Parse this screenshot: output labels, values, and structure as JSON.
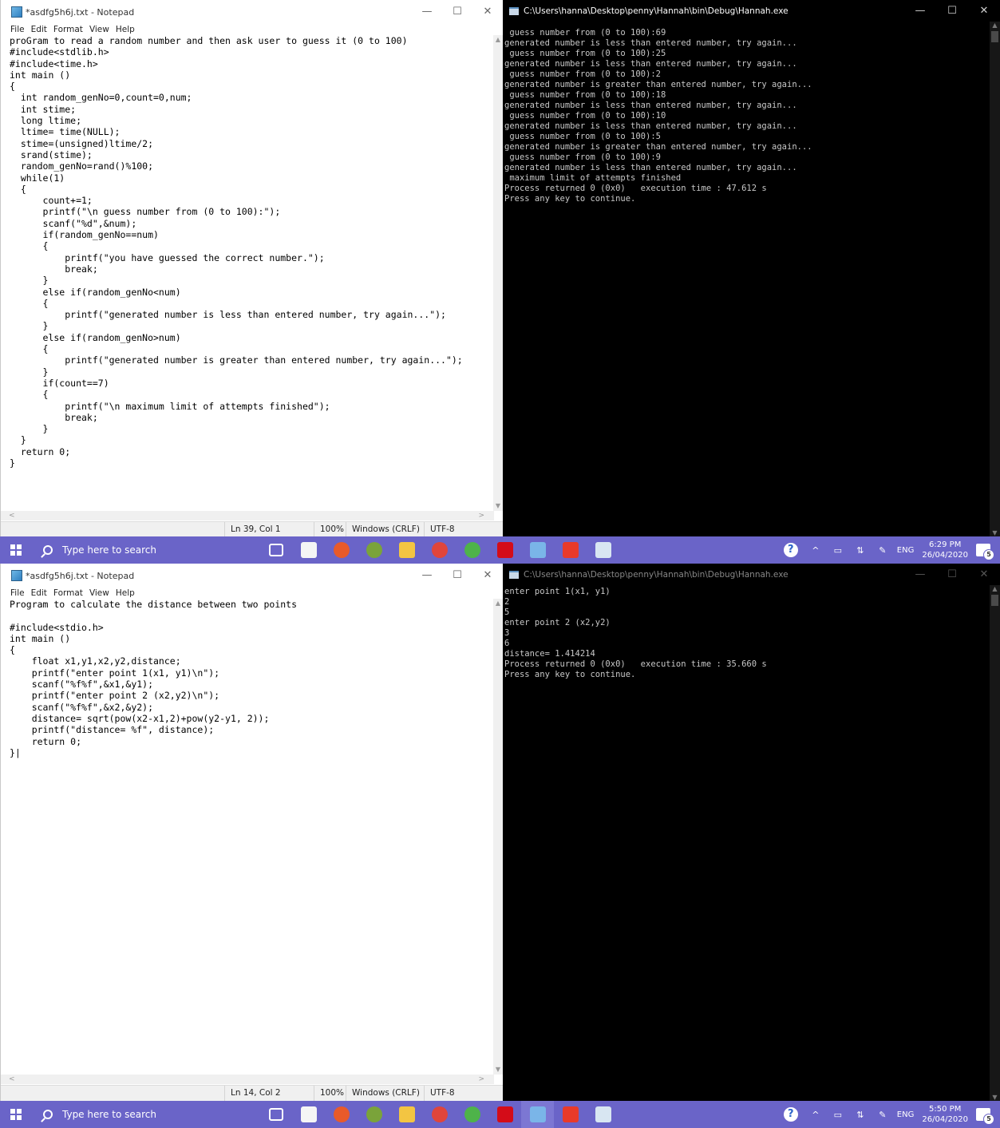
{
  "top": {
    "notepad": {
      "title": "*asdfg5h6j.txt - Notepad",
      "menu": [
        "File",
        "Edit",
        "Format",
        "View",
        "Help"
      ],
      "content": "proGram to read a random number and then ask user to guess it (0 to 100)\n#include<stdlib.h>\n#include<time.h>\nint main ()\n{\n  int random_genNo=0,count=0,num;\n  int stime;\n  long ltime;\n  ltime= time(NULL);\n  stime=(unsigned)ltime/2;\n  srand(stime);\n  random_genNo=rand()%100;\n  while(1)\n  {\n      count+=1;\n      printf(\"\\n guess number from (0 to 100):\");\n      scanf(\"%d\",&num);\n      if(random_genNo==num)\n      {\n          printf(\"you have guessed the correct number.\");\n          break;\n      }\n      else if(random_genNo<num)\n      {\n          printf(\"generated number is less than entered number, try again...\");\n      }\n      else if(random_genNo>num)\n      {\n          printf(\"generated number is greater than entered number, try again...\");\n      }\n      if(count==7)\n      {\n          printf(\"\\n maximum limit of attempts finished\");\n          break;\n      }\n  }\n  return 0;\n}",
      "status": {
        "position": "Ln 39, Col 1",
        "zoom": "100%",
        "eol": "Windows (CRLF)",
        "encoding": "UTF-8"
      }
    },
    "console": {
      "title": "C:\\Users\\hanna\\Desktop\\penny\\Hannah\\bin\\Debug\\Hannah.exe",
      "output": " guess number from (0 to 100):69\ngenerated number is less than entered number, try again...\n guess number from (0 to 100):25\ngenerated number is less than entered number, try again...\n guess number from (0 to 100):2\ngenerated number is greater than entered number, try again...\n guess number from (0 to 100):18\ngenerated number is less than entered number, try again...\n guess number from (0 to 100):10\ngenerated number is less than entered number, try again...\n guess number from (0 to 100):5\ngenerated number is greater than entered number, try again...\n guess number from (0 to 100):9\ngenerated number is less than entered number, try again...\n maximum limit of attempts finished\nProcess returned 0 (0x0)   execution time : 47.612 s\nPress any key to continue."
    },
    "taskbar": {
      "search_placeholder": "Type here to search",
      "lang": "ENG",
      "time": "6:29 PM",
      "date": "26/04/2020",
      "notif_count": "5"
    }
  },
  "bottom": {
    "notepad": {
      "title": "*asdfg5h6j.txt - Notepad",
      "menu": [
        "File",
        "Edit",
        "Format",
        "View",
        "Help"
      ],
      "content": "Program to calculate the distance between two points\n\n#include<stdio.h>\nint main ()\n{\n    float x1,y1,x2,y2,distance;\n    printf(\"enter point 1(x1, y1)\\n\");\n    scanf(\"%f%f\",&x1,&y1);\n    printf(\"enter point 2 (x2,y2)\\n\");\n    scanf(\"%f%f\",&x2,&y2);\n    distance= sqrt(pow(x2-x1,2)+pow(y2-y1, 2));\n    printf(\"distance= %f\", distance);\n    return 0;\n}|",
      "status": {
        "position": "Ln 14, Col 2",
        "zoom": "100%",
        "eol": "Windows (CRLF)",
        "encoding": "UTF-8"
      }
    },
    "console": {
      "title": "C:\\Users\\hanna\\Desktop\\penny\\Hannah\\bin\\Debug\\Hannah.exe",
      "output": "enter point 1(x1, y1)\n2\n5\nenter point 2 (x2,y2)\n3\n6\ndistance= 1.414214\nProcess returned 0 (0x0)   execution time : 35.660 s\nPress any key to continue."
    },
    "taskbar": {
      "search_placeholder": "Type here to search",
      "lang": "ENG",
      "time": "5:50 PM",
      "date": "26/04/2020",
      "notif_count": "5"
    }
  },
  "window_controls": {
    "minimize": "—",
    "maximize": "☐",
    "close": "✕"
  },
  "taskbar_apps": [
    {
      "name": "task-view",
      "color": "#ffffff"
    },
    {
      "name": "store",
      "color": "#f5f5f5"
    },
    {
      "name": "media-player",
      "color": "#e85a2a"
    },
    {
      "name": "codeblocks",
      "color": "#7aa33a"
    },
    {
      "name": "file-explorer",
      "color": "#f3c542"
    },
    {
      "name": "chrome",
      "color": "#e0453b"
    },
    {
      "name": "utorrent",
      "color": "#4eb34a"
    },
    {
      "name": "netflix",
      "color": "#d40c18"
    },
    {
      "name": "notepad",
      "color": "#7ab5e8"
    },
    {
      "name": "codeblocks-ide",
      "color": "#e83a2a"
    },
    {
      "name": "console",
      "color": "#d8e6f2"
    }
  ],
  "colors": {
    "taskbar": "#6a64c8",
    "console_bg": "#000000",
    "console_text": "#c8c8c8"
  }
}
